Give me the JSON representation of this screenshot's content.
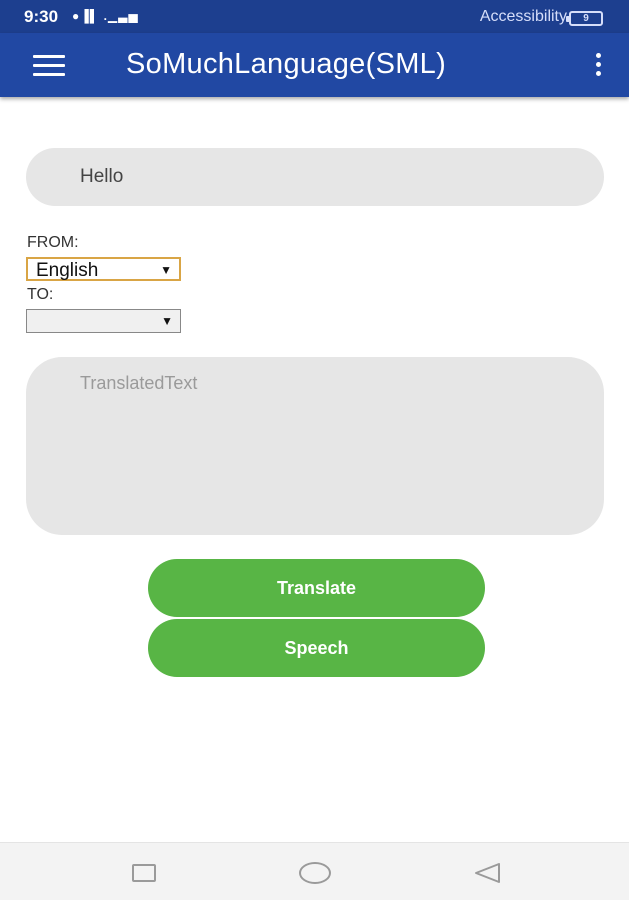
{
  "status_bar": {
    "time": "9:30",
    "signal": "ᵛᵒ",
    "accessibility": "Accessibility",
    "battery": "9"
  },
  "app_bar": {
    "title": "SoMuchLanguage(SML)"
  },
  "input": {
    "value": "Hello"
  },
  "from": {
    "label": "FROM:",
    "selected": "English"
  },
  "to": {
    "label": "TO:",
    "selected": ""
  },
  "output": {
    "placeholder": "TranslatedText"
  },
  "buttons": {
    "translate": "Translate",
    "speech": "Speech"
  },
  "colors": {
    "status_bar": "#1d3f8f",
    "app_bar": "#2148a3",
    "button_green": "#58b545",
    "field_gray": "#e6e6e6"
  }
}
